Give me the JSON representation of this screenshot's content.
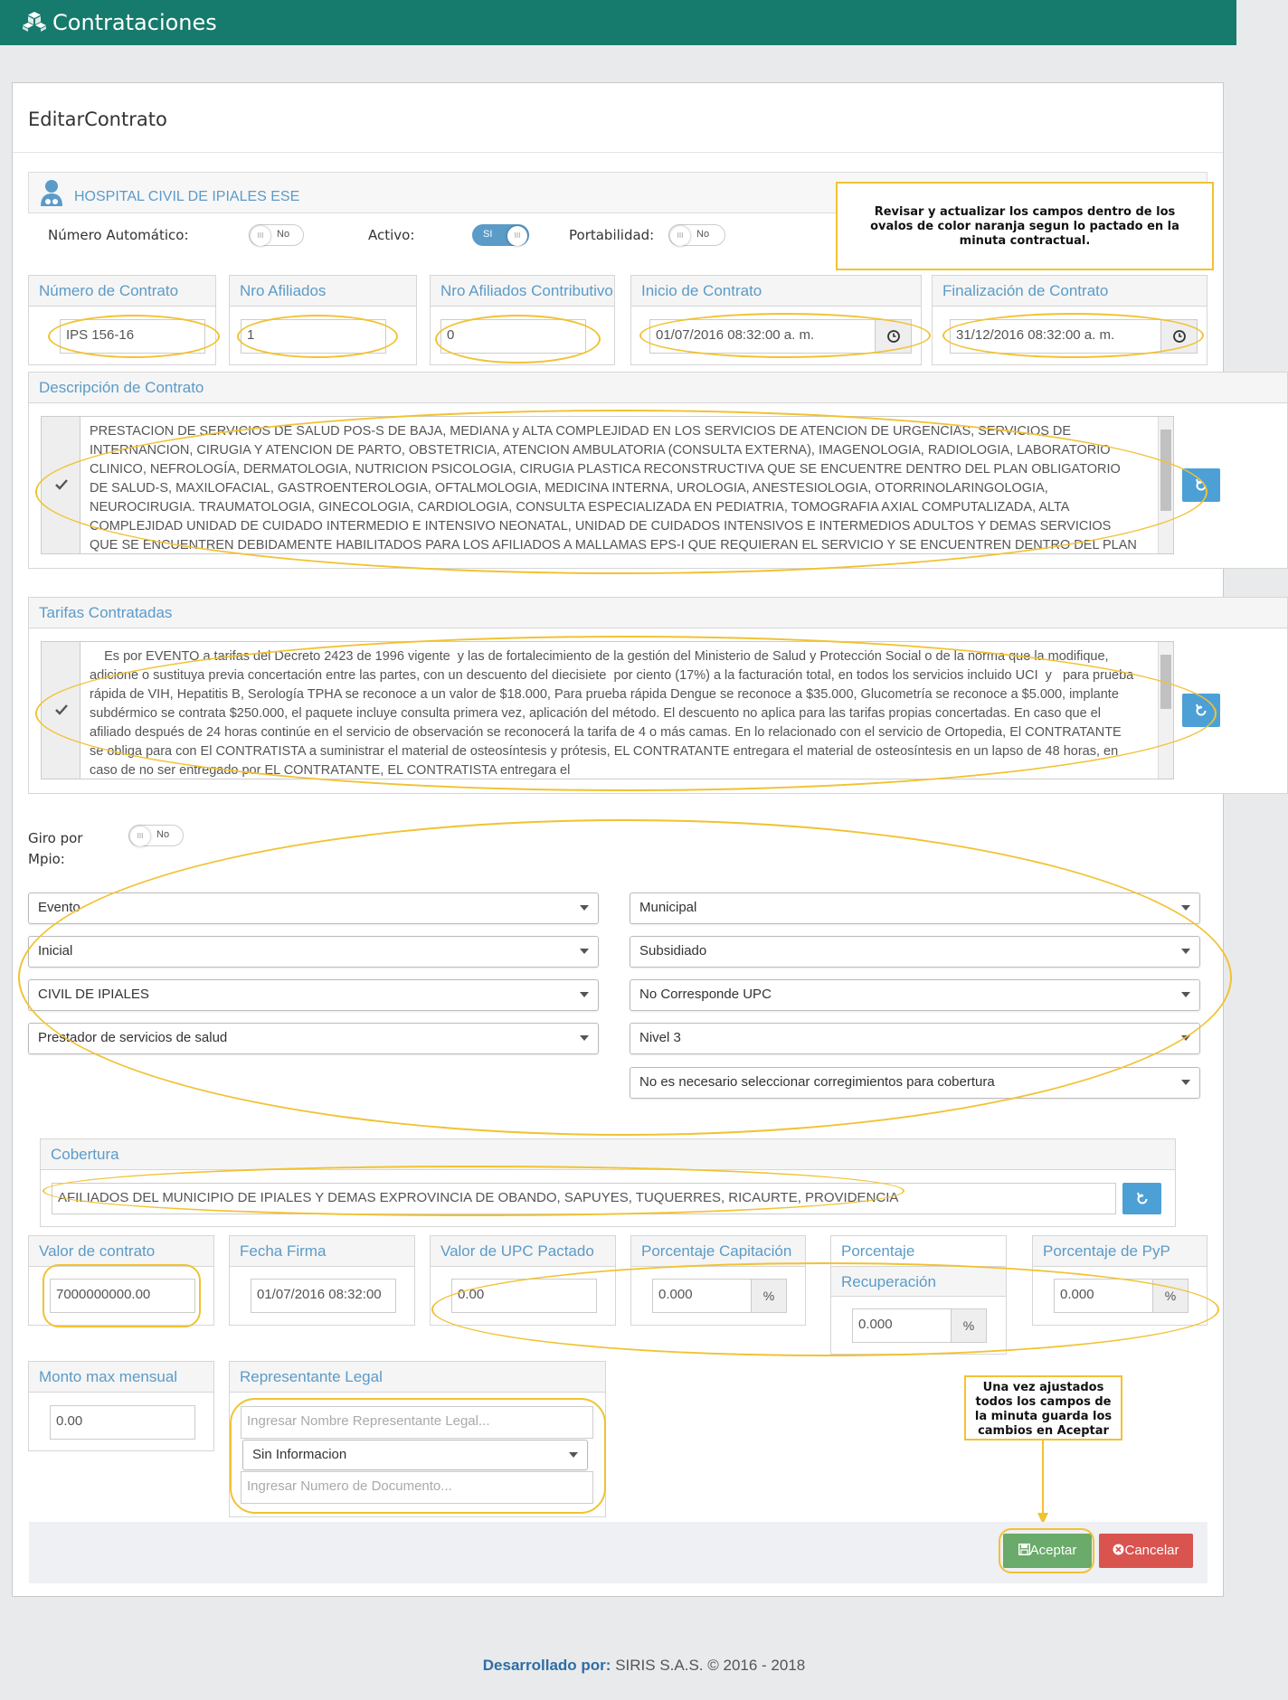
{
  "header": {
    "title": "Contrataciones",
    "icon": "cubes-icon"
  },
  "card": {
    "title": "EditarContrato"
  },
  "hospital": {
    "name": "HOSPITAL CIVIL DE IPIALES ESE"
  },
  "toggles": {
    "numero_automatico": {
      "label": "Número Automático:",
      "value": "No"
    },
    "activo": {
      "label": "Activo:",
      "value": "SI"
    },
    "portabilidad": {
      "label": "Portabilidad:",
      "value": "No"
    },
    "giro_mpio": {
      "label": "Giro por Mpio:",
      "value": "No"
    }
  },
  "note_top": "Revisar y actualizar los campos dentro de los ovalos de color naranja segun lo pactado en la minuta contractual.",
  "fields": {
    "numero_contrato": {
      "label": "Número de Contrato",
      "value": "IPS 156-16"
    },
    "nro_afiliados": {
      "label": "Nro Afiliados",
      "value": "1"
    },
    "nro_afiliados_contrib": {
      "label": "Nro Afiliados Contributivo",
      "value": "0"
    },
    "inicio": {
      "label": "Inicio de Contrato",
      "value": "01/07/2016 08:32:00 a. m."
    },
    "fin": {
      "label": "Finalización de Contrato",
      "value": "31/12/2016 08:32:00 a. m."
    }
  },
  "descripcion": {
    "label": "Descripción de Contrato",
    "text": "PRESTACION DE SERVICIOS DE SALUD POS-S DE BAJA, MEDIANA y ALTA COMPLEJIDAD EN LOS SERVICIOS DE ATENCION DE URGENCIAS, SERVICIOS DE INTERNANCION, CIRUGIA Y ATENCION DE PARTO, OBSTETRICIA, ATENCION AMBULATORIA (CONSULTA EXTERNA), IMAGENOLOGIA, RADIOLOGIA, LABORATORIO CLINICO, NEFROLOGÍA, DERMATOLOGIA, NUTRICION PSICOLOGIA, CIRUGIA PLASTICA RECONSTRUCTIVA QUE SE ENCUENTRE DENTRO DEL PLAN OBLIGATORIO DE SALUD-S, MAXILOFACIAL, GASTROENTEROLOGIA, OFTALMOLOGIA, MEDICINA INTERNA, UROLOGIA, ANESTESIOLOGIA, OTORRINOLARINGOLOGIA, NEUROCIRUGIA. TRAUMATOLOGIA, GINECOLOGIA, CARDIOLOGIA, CONSULTA ESPECIALIZADA EN PEDIATRIA, TOMOGRAFIA AXIAL COMPUTALIZADA, ALTA COMPLEJIDAD UNIDAD DE CUIDADO INTERMEDIO E INTENSIVO NEONATAL, UNIDAD DE CUIDADOS INTENSIVOS E INTERMEDIOS  ADULTOS  Y DEMAS SERVICIOS QUE SE ENCUENTREN DEBIDAMENTE HABILITADOS PARA LOS AFILIADOS A MALLAMAS EPS-I QUE REQUIERAN EL SERVICIO Y SE ENCUENTREN DENTRO DEL PLAN OBLIGATORIO DE"
  },
  "tarifas": {
    "label": "Tarifas Contratadas",
    "text": "    Es por EVENTO a tarifas del Decreto 2423 de 1996 vigente  y las de fortalecimiento de la gestión del Ministerio de Salud y Protección Social o de la norma que la modifique, adicione o sustituya previa concertación entre las partes, con un descuento del diecisiete  por ciento (17%) a la facturación total, en todos los servicios incluido UCI  y   para prueba rápida de VIH, Hepatitis B, Serología TPHA se reconoce a un valor de $18.000, Para prueba rápida Dengue se reconoce a $35.000, Glucometría se reconoce a $5.000, implante subdérmico se contrata $250.000, el paquete incluye consulta primera vez, aplicación del método. El descuento no aplica para las tarifas propias concertadas. En caso que el afiliado después de 24 horas continúe en el servicio de observación se reconocerá la tarifa de 4 o más camas. En lo relacionado con el servicio de Ortopedia, El CONTRATANTE se obliga para con El CONTRATISTA a suministrar el material de osteosíntesis y prótesis, EL CONTRATANTE entregara el material de osteosíntesis en un lapso de 48 horas, en caso de no ser entregado por EL CONTRATANTE, EL CONTRATISTA entregara el"
  },
  "selects_left": [
    "Evento",
    "Inicial",
    "CIVIL DE IPIALES",
    "Prestador de servicios de salud"
  ],
  "selects_right": [
    "Municipal",
    "Subsidiado",
    "No Corresponde UPC",
    "Nivel 3",
    "No es necesario seleccionar corregimientos para cobertura"
  ],
  "cobertura": {
    "label": "Cobertura",
    "value": "AFILIADOS DEL MUNICIPIO DE IPIALES Y DEMAS EXPROVINCIA DE OBANDO, SAPUYES, TUQUERRES, RICAURTE, PROVIDENCIA"
  },
  "valores": {
    "valor_contrato": {
      "label": "Valor de contrato",
      "value": "7000000000.00"
    },
    "fecha_firma": {
      "label": "Fecha Firma",
      "value": "01/07/2016 08:32:00"
    },
    "valor_upc": {
      "label": "Valor de UPC Pactado",
      "value": "0.00"
    },
    "porc_capitacion": {
      "label": "Porcentaje Capitación",
      "value": "0.000",
      "unit": "%"
    },
    "porc_recuperacion": {
      "label": "Porcentaje",
      "label2": "Recuperación",
      "value": "0.000",
      "unit": "%"
    },
    "porc_pyp": {
      "label": "Porcentaje de PyP",
      "value": "0.000",
      "unit": "%"
    }
  },
  "monto": {
    "label": "Monto max mensual",
    "value": "0.00"
  },
  "representante": {
    "label": "Representante Legal",
    "nombre_placeholder": "Ingresar Nombre Representante Legal...",
    "tipo_doc": "Sin Informacion",
    "doc_placeholder": "Ingresar Numero de Documento..."
  },
  "note_bottom": "Una vez ajustados todos los campos de la minuta guarda los cambios en Aceptar",
  "buttons": {
    "aceptar": "Aceptar",
    "cancelar": "Cancelar"
  },
  "footer": {
    "dev_label": "Desarrollado por:",
    "company": "SIRIS S.A.S. © 2016 - 2018"
  },
  "colors": {
    "header": "#167a6c",
    "accent": "#5b9bc8",
    "oval": "#f1c232",
    "accept": "#6aaa6a",
    "cancel": "#d9534f"
  }
}
